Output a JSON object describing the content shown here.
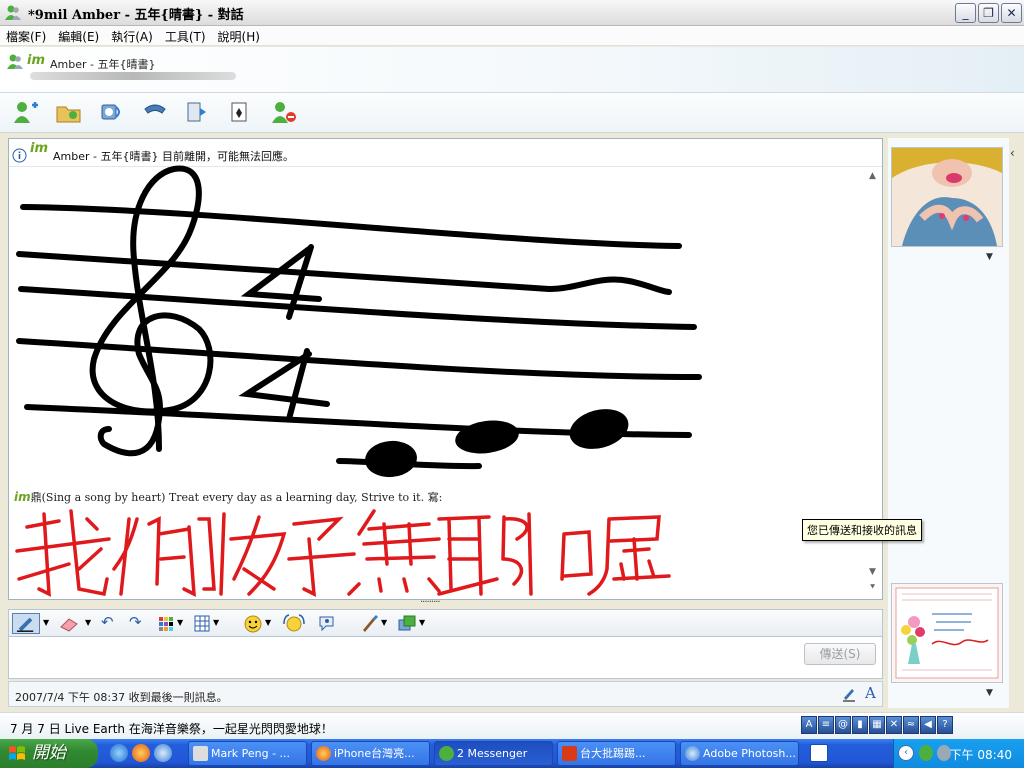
{
  "window": {
    "title": "*9mil Amber - 五年{晴書} - 對話",
    "minimize": "_",
    "restore": "❐",
    "close": "✕"
  },
  "menu": [
    "檔案(F)",
    "編輯(E)",
    "執行(A)",
    "工具(T)",
    "說明(H)"
  ],
  "contact": {
    "name": "Amber - 五年{晴書}",
    "im_logo": "im"
  },
  "conversation": {
    "status_message": "Amber - 五年{晴書} 目前離開，可能無法回應。",
    "im_logo": "im",
    "second_message": "鼎(Sing a song by heart) Treat every day as a learning day, Strive to it. 寫:",
    "handwriting": "我們好無聊喔"
  },
  "splitter": "·········",
  "send_button": "傳送(S)",
  "status_bar": "2007/7/4 下午 08:37 收到最後一則訊息。",
  "ticker": "7 月 7 日 Live Earth 在海洋音樂祭，一起星光閃閃愛地球！",
  "tooltip": "您已傳送和接收的訊息",
  "taskbar": {
    "start": "開始",
    "tasks": [
      "Mark Peng - ...",
      "iPhone台灣亮...",
      "2 Messenger",
      "台大批踢踢...",
      "Adobe Photosh..."
    ],
    "clock": "下午 08:40"
  },
  "colors": {
    "accent": "#2157d6",
    "handwriting": "#e0191c",
    "ink": "#000000"
  }
}
